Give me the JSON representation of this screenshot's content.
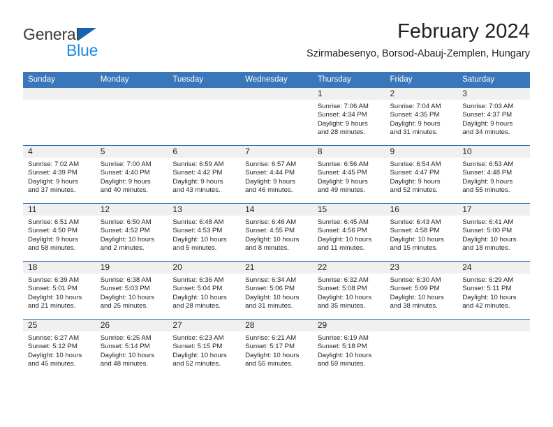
{
  "brand": {
    "line1": "General",
    "line2": "Blue",
    "triangle_color": "#1565b0",
    "line2_color": "#1f8ae0"
  },
  "header": {
    "title": "February 2024",
    "subtitle": "Szirmabesenyo, Borsod-Abauj-Zemplen, Hungary"
  },
  "theme": {
    "header_blue": "#3a76ba",
    "separator_blue": "#2a6cb0",
    "daynum_bg": "#f0f0f0",
    "text": "#231f20"
  },
  "weekdays": [
    "Sunday",
    "Monday",
    "Tuesday",
    "Wednesday",
    "Thursday",
    "Friday",
    "Saturday"
  ],
  "weeks": [
    [
      {
        "day": "",
        "l1": "",
        "l2": "",
        "l3": "",
        "l4": ""
      },
      {
        "day": "",
        "l1": "",
        "l2": "",
        "l3": "",
        "l4": ""
      },
      {
        "day": "",
        "l1": "",
        "l2": "",
        "l3": "",
        "l4": ""
      },
      {
        "day": "",
        "l1": "",
        "l2": "",
        "l3": "",
        "l4": ""
      },
      {
        "day": "1",
        "l1": "Sunrise: 7:06 AM",
        "l2": "Sunset: 4:34 PM",
        "l3": "Daylight: 9 hours",
        "l4": "and 28 minutes."
      },
      {
        "day": "2",
        "l1": "Sunrise: 7:04 AM",
        "l2": "Sunset: 4:35 PM",
        "l3": "Daylight: 9 hours",
        "l4": "and 31 minutes."
      },
      {
        "day": "3",
        "l1": "Sunrise: 7:03 AM",
        "l2": "Sunset: 4:37 PM",
        "l3": "Daylight: 9 hours",
        "l4": "and 34 minutes."
      }
    ],
    [
      {
        "day": "4",
        "l1": "Sunrise: 7:02 AM",
        "l2": "Sunset: 4:39 PM",
        "l3": "Daylight: 9 hours",
        "l4": "and 37 minutes."
      },
      {
        "day": "5",
        "l1": "Sunrise: 7:00 AM",
        "l2": "Sunset: 4:40 PM",
        "l3": "Daylight: 9 hours",
        "l4": "and 40 minutes."
      },
      {
        "day": "6",
        "l1": "Sunrise: 6:59 AM",
        "l2": "Sunset: 4:42 PM",
        "l3": "Daylight: 9 hours",
        "l4": "and 43 minutes."
      },
      {
        "day": "7",
        "l1": "Sunrise: 6:57 AM",
        "l2": "Sunset: 4:44 PM",
        "l3": "Daylight: 9 hours",
        "l4": "and 46 minutes."
      },
      {
        "day": "8",
        "l1": "Sunrise: 6:56 AM",
        "l2": "Sunset: 4:45 PM",
        "l3": "Daylight: 9 hours",
        "l4": "and 49 minutes."
      },
      {
        "day": "9",
        "l1": "Sunrise: 6:54 AM",
        "l2": "Sunset: 4:47 PM",
        "l3": "Daylight: 9 hours",
        "l4": "and 52 minutes."
      },
      {
        "day": "10",
        "l1": "Sunrise: 6:53 AM",
        "l2": "Sunset: 4:48 PM",
        "l3": "Daylight: 9 hours",
        "l4": "and 55 minutes."
      }
    ],
    [
      {
        "day": "11",
        "l1": "Sunrise: 6:51 AM",
        "l2": "Sunset: 4:50 PM",
        "l3": "Daylight: 9 hours",
        "l4": "and 58 minutes."
      },
      {
        "day": "12",
        "l1": "Sunrise: 6:50 AM",
        "l2": "Sunset: 4:52 PM",
        "l3": "Daylight: 10 hours",
        "l4": "and 2 minutes."
      },
      {
        "day": "13",
        "l1": "Sunrise: 6:48 AM",
        "l2": "Sunset: 4:53 PM",
        "l3": "Daylight: 10 hours",
        "l4": "and 5 minutes."
      },
      {
        "day": "14",
        "l1": "Sunrise: 6:46 AM",
        "l2": "Sunset: 4:55 PM",
        "l3": "Daylight: 10 hours",
        "l4": "and 8 minutes."
      },
      {
        "day": "15",
        "l1": "Sunrise: 6:45 AM",
        "l2": "Sunset: 4:56 PM",
        "l3": "Daylight: 10 hours",
        "l4": "and 11 minutes."
      },
      {
        "day": "16",
        "l1": "Sunrise: 6:43 AM",
        "l2": "Sunset: 4:58 PM",
        "l3": "Daylight: 10 hours",
        "l4": "and 15 minutes."
      },
      {
        "day": "17",
        "l1": "Sunrise: 6:41 AM",
        "l2": "Sunset: 5:00 PM",
        "l3": "Daylight: 10 hours",
        "l4": "and 18 minutes."
      }
    ],
    [
      {
        "day": "18",
        "l1": "Sunrise: 6:39 AM",
        "l2": "Sunset: 5:01 PM",
        "l3": "Daylight: 10 hours",
        "l4": "and 21 minutes."
      },
      {
        "day": "19",
        "l1": "Sunrise: 6:38 AM",
        "l2": "Sunset: 5:03 PM",
        "l3": "Daylight: 10 hours",
        "l4": "and 25 minutes."
      },
      {
        "day": "20",
        "l1": "Sunrise: 6:36 AM",
        "l2": "Sunset: 5:04 PM",
        "l3": "Daylight: 10 hours",
        "l4": "and 28 minutes."
      },
      {
        "day": "21",
        "l1": "Sunrise: 6:34 AM",
        "l2": "Sunset: 5:06 PM",
        "l3": "Daylight: 10 hours",
        "l4": "and 31 minutes."
      },
      {
        "day": "22",
        "l1": "Sunrise: 6:32 AM",
        "l2": "Sunset: 5:08 PM",
        "l3": "Daylight: 10 hours",
        "l4": "and 35 minutes."
      },
      {
        "day": "23",
        "l1": "Sunrise: 6:30 AM",
        "l2": "Sunset: 5:09 PM",
        "l3": "Daylight: 10 hours",
        "l4": "and 38 minutes."
      },
      {
        "day": "24",
        "l1": "Sunrise: 6:29 AM",
        "l2": "Sunset: 5:11 PM",
        "l3": "Daylight: 10 hours",
        "l4": "and 42 minutes."
      }
    ],
    [
      {
        "day": "25",
        "l1": "Sunrise: 6:27 AM",
        "l2": "Sunset: 5:12 PM",
        "l3": "Daylight: 10 hours",
        "l4": "and 45 minutes."
      },
      {
        "day": "26",
        "l1": "Sunrise: 6:25 AM",
        "l2": "Sunset: 5:14 PM",
        "l3": "Daylight: 10 hours",
        "l4": "and 48 minutes."
      },
      {
        "day": "27",
        "l1": "Sunrise: 6:23 AM",
        "l2": "Sunset: 5:15 PM",
        "l3": "Daylight: 10 hours",
        "l4": "and 52 minutes."
      },
      {
        "day": "28",
        "l1": "Sunrise: 6:21 AM",
        "l2": "Sunset: 5:17 PM",
        "l3": "Daylight: 10 hours",
        "l4": "and 55 minutes."
      },
      {
        "day": "29",
        "l1": "Sunrise: 6:19 AM",
        "l2": "Sunset: 5:18 PM",
        "l3": "Daylight: 10 hours",
        "l4": "and 59 minutes."
      },
      {
        "day": "",
        "l1": "",
        "l2": "",
        "l3": "",
        "l4": ""
      },
      {
        "day": "",
        "l1": "",
        "l2": "",
        "l3": "",
        "l4": ""
      }
    ]
  ]
}
